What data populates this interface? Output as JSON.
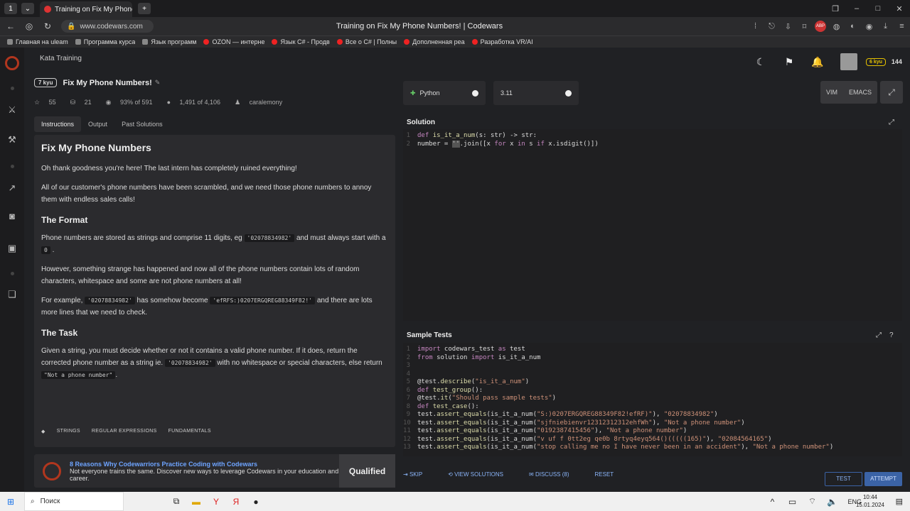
{
  "browser": {
    "tab_count": "1",
    "tab_title": "Training on Fix My Phone",
    "url": "www.codewars.com",
    "page_title": "Training on Fix My Phone Numbers! | Codewars",
    "adblock": "ABP"
  },
  "bookmarks": [
    "Главная на uleam",
    "Программа курса",
    "Язык программ",
    "OZON — интерне",
    "Язык C# - Продв",
    "Все о C# | Полны",
    "Дополненная реа",
    "Разработка VR/AI"
  ],
  "kata": {
    "section": "Kata Training",
    "kyu": "7 kyu",
    "title": "Fix My Phone Numbers!",
    "stars": "55",
    "collections": "21",
    "satisfaction": "93% of 591",
    "completed": "1,491 of 4,106",
    "author": "caralemony"
  },
  "tabs": {
    "instructions": "Instructions",
    "output": "Output",
    "past": "Past Solutions"
  },
  "desc": {
    "h1": "Fix My Phone Numbers",
    "p1": "Oh thank goodness you're here! The last intern has completely ruined everything!",
    "p2": "All of our customer's phone numbers have been scrambled, and we need those phone numbers to annoy them with endless sales calls!",
    "h_format": "The Format",
    "p3a": "Phone numbers are stored as strings and comprise 11 digits, eg",
    "p3code": "'02078834982'",
    "p3b": "and must always start with a",
    "p3code2": "0",
    "p3c": ".",
    "p4": "However, something strange has happened and now all of the phone numbers contain lots of random characters, whitespace and some are not phone numbers at all!",
    "p5a": "For example,",
    "p5code": "'02078834982'",
    "p5b": "has somehow become",
    "p5code2": "'efRFS:)0207ERGQREG88349F82!'",
    "p5c": "and there are lots more lines that we need to check.",
    "h_task": "The Task",
    "p6a": "Given a string, you must decide whether or not it contains a valid phone number. If it does, return the corrected phone number as a string ie.",
    "p6code": "'02078834982'",
    "p6b": "with no whitespace or special characters, else return",
    "p6code2": "\"Not a phone number\"",
    "p6c": "."
  },
  "tags": [
    "STRINGS",
    "REGULAR EXPRESSIONS",
    "FUNDAMENTALS"
  ],
  "ad": {
    "title": "8 Reasons Why Codewarriors Practice Coding with Codewars",
    "text": "Not everyone trains the same. Discover new ways to leverage Codewars in your education and career.",
    "brand": "Qualified"
  },
  "editor": {
    "language": "Python",
    "version": "3.11",
    "vim": "VIM",
    "emacs": "EMACS",
    "solution_title": "Solution",
    "tests_title": "Sample Tests"
  },
  "user": {
    "kyu": "6 kyu",
    "honor": "144"
  },
  "actions": {
    "skip": "SKIP",
    "view": "VIEW SOLUTIONS",
    "discuss": "DISCUSS (8)",
    "reset": "RESET",
    "test": "TEST",
    "attempt": "ATTEMPT"
  },
  "taskbar": {
    "search": "Поиск",
    "lang": "ENG",
    "time": "10:44",
    "date": "15.01.2024"
  }
}
